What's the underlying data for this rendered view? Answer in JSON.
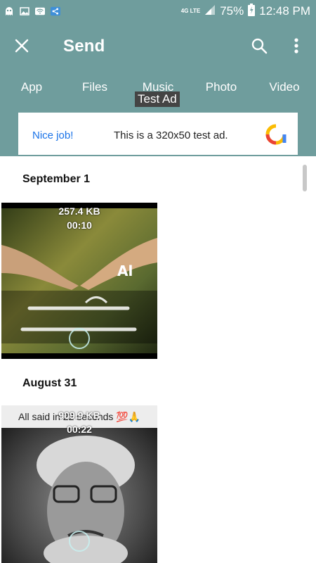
{
  "status_bar": {
    "battery": "75%",
    "time": "12:48 PM",
    "network": "4G LTE",
    "icons": [
      "ghost-icon",
      "image-icon",
      "wifi-icon",
      "share-icon"
    ]
  },
  "app_bar": {
    "title": "Send",
    "close_icon": "close-icon",
    "search_icon": "search-icon",
    "more_icon": "more-vert-icon"
  },
  "tabs": [
    {
      "label": "App"
    },
    {
      "label": "Files"
    },
    {
      "label": "Music"
    },
    {
      "label": "Photo"
    },
    {
      "label": "Video"
    }
  ],
  "ad": {
    "label": "Test Ad",
    "nice": "Nice job!",
    "text": "This is a 320x50 test ad."
  },
  "sections": [
    {
      "date": "September 1",
      "video": {
        "size": "257.4 KB",
        "duration": "00:10"
      }
    },
    {
      "date": "August 31",
      "video": {
        "size": "909.9 KB",
        "duration": "00:22",
        "overlay": "All said in 22 seconds 💯🙏"
      }
    }
  ],
  "colors": {
    "accent": "#6f9d9d",
    "ad_link": "#1a73e8"
  }
}
